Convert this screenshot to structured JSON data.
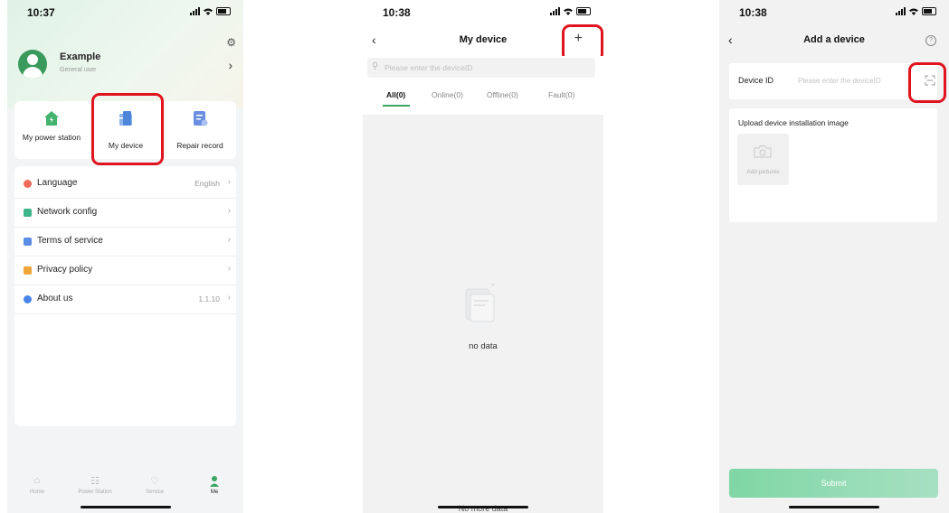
{
  "screens": {
    "me": {
      "time": "10:37",
      "user": {
        "name": "Example",
        "role": "General user"
      },
      "quick_actions": [
        {
          "label": "My power station",
          "icon": "house-icon",
          "color": "#41b36d"
        },
        {
          "label": "My device",
          "icon": "device-icon",
          "color": "#6a9ee0"
        },
        {
          "label": "Repair record",
          "icon": "clipboard-icon",
          "color": "#6a8fe0"
        }
      ],
      "menu": [
        {
          "label": "Language",
          "value": "English",
          "icon": "globe-icon",
          "color": "#f06a5a"
        },
        {
          "label": "Network config",
          "value": "",
          "icon": "network-icon",
          "color": "#3fb68a"
        },
        {
          "label": "Terms of service",
          "value": "",
          "icon": "document-icon",
          "color": "#5b8de6"
        },
        {
          "label": "Privacy policy",
          "value": "",
          "icon": "lock-doc-icon",
          "color": "#f0a43a"
        },
        {
          "label": "About us",
          "value": "1.1.10",
          "icon": "info-icon",
          "color": "#4a86e8"
        }
      ],
      "tabbar": [
        {
          "label": "Home",
          "icon": "home-icon",
          "active": false
        },
        {
          "label": "Power Station",
          "icon": "grid-icon",
          "active": false
        },
        {
          "label": "Service",
          "icon": "service-icon",
          "active": false
        },
        {
          "label": "Me",
          "icon": "person-icon",
          "active": true
        }
      ]
    },
    "my_device": {
      "time": "10:38",
      "title": "My device",
      "search_placeholder": "Please enter the deviceID",
      "filters": [
        "All(0)",
        "Online(0)",
        "Offline(0)",
        "Fault(0)"
      ],
      "active_filter": "All(0)",
      "empty_text": "no data",
      "footer_text": "No more data"
    },
    "add_device": {
      "time": "10:38",
      "title": "Add a device",
      "device_id_label": "Device ID",
      "device_id_placeholder": "Please enter the deviceID",
      "upload_label": "Upload device installation image",
      "add_pictures_label": "Add pictures",
      "submit_label": "Submit"
    }
  },
  "colors": {
    "accent": "#3aa764",
    "highlight": "#e0141e"
  }
}
